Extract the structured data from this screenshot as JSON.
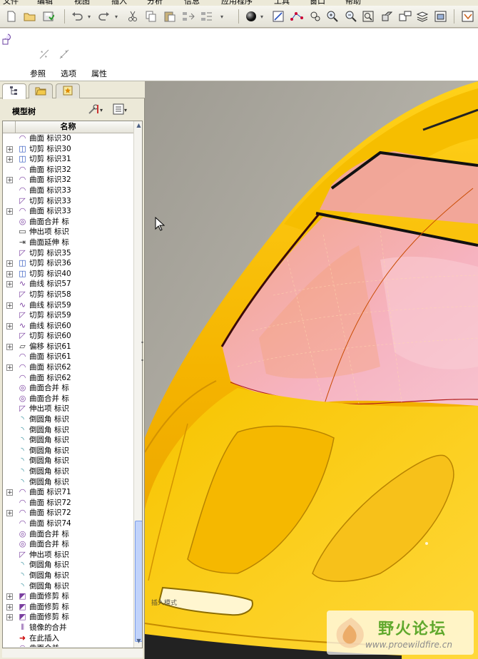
{
  "menubar": {
    "items": [
      "文件",
      "编辑",
      "视图",
      "插入",
      "分析",
      "信息",
      "应用程序",
      "工具",
      "窗口",
      "帮助"
    ]
  },
  "toolbar": {
    "icons": [
      "new-file-icon",
      "open-folder-icon",
      "save-icon",
      "undo-icon",
      "redo-icon",
      "cut-icon",
      "copy-icon",
      "paste-icon",
      "regenerate-icon",
      "shaded-sphere-icon",
      "sketch-icon",
      "datum-icon",
      "zoom-in-icon",
      "zoom-out-icon",
      "refit-icon",
      "layer-icon",
      "view-icon"
    ]
  },
  "dashboard": {
    "tabs": [
      {
        "label": "参照"
      },
      {
        "label": "选项"
      },
      {
        "label": "属性"
      }
    ]
  },
  "navigator": {
    "tree_title": "模型树",
    "column_header": "名称",
    "rows": [
      {
        "expander": "",
        "icon": "surface-icon",
        "label": "曲面 标识30"
      },
      {
        "expander": "+",
        "icon": "cut-icon",
        "label": "切剪 标识30"
      },
      {
        "expander": "+",
        "icon": "cut-icon",
        "label": "切剪 标识31"
      },
      {
        "expander": "",
        "icon": "surface-icon",
        "label": "曲面 标识32"
      },
      {
        "expander": "+",
        "icon": "surface-icon",
        "label": "曲面 标识32"
      },
      {
        "expander": "",
        "icon": "surface-icon",
        "label": "曲面 标识33"
      },
      {
        "expander": "",
        "icon": "trim-icon",
        "label": "切剪 标识33"
      },
      {
        "expander": "+",
        "icon": "surface-icon",
        "label": "曲面 标识33"
      },
      {
        "expander": "",
        "icon": "merge-icon",
        "label": "曲面合并 标"
      },
      {
        "expander": "",
        "icon": "extrude-icon",
        "label": "伸出项 标识"
      },
      {
        "expander": "",
        "icon": "extend-icon",
        "label": "曲面延伸 标"
      },
      {
        "expander": "",
        "icon": "trim-icon",
        "label": "切剪 标识35"
      },
      {
        "expander": "+",
        "icon": "cut-icon",
        "label": "切剪 标识36"
      },
      {
        "expander": "+",
        "icon": "cut-icon",
        "label": "切剪 标识40"
      },
      {
        "expander": "+",
        "icon": "curve-icon",
        "label": "曲线 标识57"
      },
      {
        "expander": "",
        "icon": "trim-icon",
        "label": "切剪 标识58"
      },
      {
        "expander": "+",
        "icon": "curve-icon",
        "label": "曲线 标识59"
      },
      {
        "expander": "",
        "icon": "trim-icon",
        "label": "切剪 标识59"
      },
      {
        "expander": "+",
        "icon": "curve-icon",
        "label": "曲线 标识60"
      },
      {
        "expander": "",
        "icon": "trim-icon",
        "label": "切剪 标识60"
      },
      {
        "expander": "+",
        "icon": "offset-icon",
        "label": "偏移 标识61"
      },
      {
        "expander": "",
        "icon": "surface-icon",
        "label": "曲面 标识61"
      },
      {
        "expander": "+",
        "icon": "surface-icon",
        "label": "曲面 标识62"
      },
      {
        "expander": "",
        "icon": "surface-icon",
        "label": "曲面 标识62"
      },
      {
        "expander": "",
        "icon": "merge-icon",
        "label": "曲面合并 标"
      },
      {
        "expander": "",
        "icon": "merge-icon",
        "label": "曲面合并 标"
      },
      {
        "expander": "",
        "icon": "trim-icon",
        "label": "伸出项 标识"
      },
      {
        "expander": "",
        "icon": "round-icon",
        "label": "倒圆角 标识"
      },
      {
        "expander": "",
        "icon": "round-icon",
        "label": "倒圆角 标识"
      },
      {
        "expander": "",
        "icon": "round-icon",
        "label": "倒圆角 标识"
      },
      {
        "expander": "",
        "icon": "round-icon",
        "label": "倒圆角 标识"
      },
      {
        "expander": "",
        "icon": "round-icon",
        "label": "倒圆角 标识"
      },
      {
        "expander": "",
        "icon": "round-icon",
        "label": "倒圆角 标识"
      },
      {
        "expander": "",
        "icon": "round-icon",
        "label": "倒圆角 标识"
      },
      {
        "expander": "+",
        "icon": "surface-icon",
        "label": "曲面 标识71"
      },
      {
        "expander": "",
        "icon": "surface-icon",
        "label": "曲面 标识72"
      },
      {
        "expander": "+",
        "icon": "surface-icon",
        "label": "曲面 标识72"
      },
      {
        "expander": "",
        "icon": "surface-icon",
        "label": "曲面 标识74"
      },
      {
        "expander": "",
        "icon": "merge-icon",
        "label": "曲面合并 标"
      },
      {
        "expander": "",
        "icon": "merge-icon",
        "label": "曲面合并 标"
      },
      {
        "expander": "",
        "icon": "trim-icon",
        "label": "伸出项 标识"
      },
      {
        "expander": "",
        "icon": "round-icon",
        "label": "倒圆角 标识"
      },
      {
        "expander": "",
        "icon": "round-icon",
        "label": "倒圆角 标识"
      },
      {
        "expander": "",
        "icon": "round-icon",
        "label": "倒圆角 标识"
      },
      {
        "expander": "+",
        "icon": "surface-trim-icon",
        "label": "曲面修剪 标"
      },
      {
        "expander": "+",
        "icon": "surface-trim-icon",
        "label": "曲面修剪 标"
      },
      {
        "expander": "+",
        "icon": "surface-trim-icon",
        "label": "曲面修剪 标"
      },
      {
        "expander": "",
        "icon": "mirror-icon",
        "label": "镜像的合并"
      },
      {
        "expander": "",
        "icon": "insert-arrow-icon",
        "label": "在此插入"
      },
      {
        "expander": "",
        "icon": "merge-icon",
        "label": "曲面合并"
      }
    ]
  },
  "viewport": {
    "mode_label": "插入模式",
    "body_color": "#f2b705",
    "glass_color": "#f5a9b8",
    "background_color": "#b9b5aa"
  },
  "watermark": {
    "title": "野火论坛",
    "url": "www.proewildfire.cn"
  }
}
